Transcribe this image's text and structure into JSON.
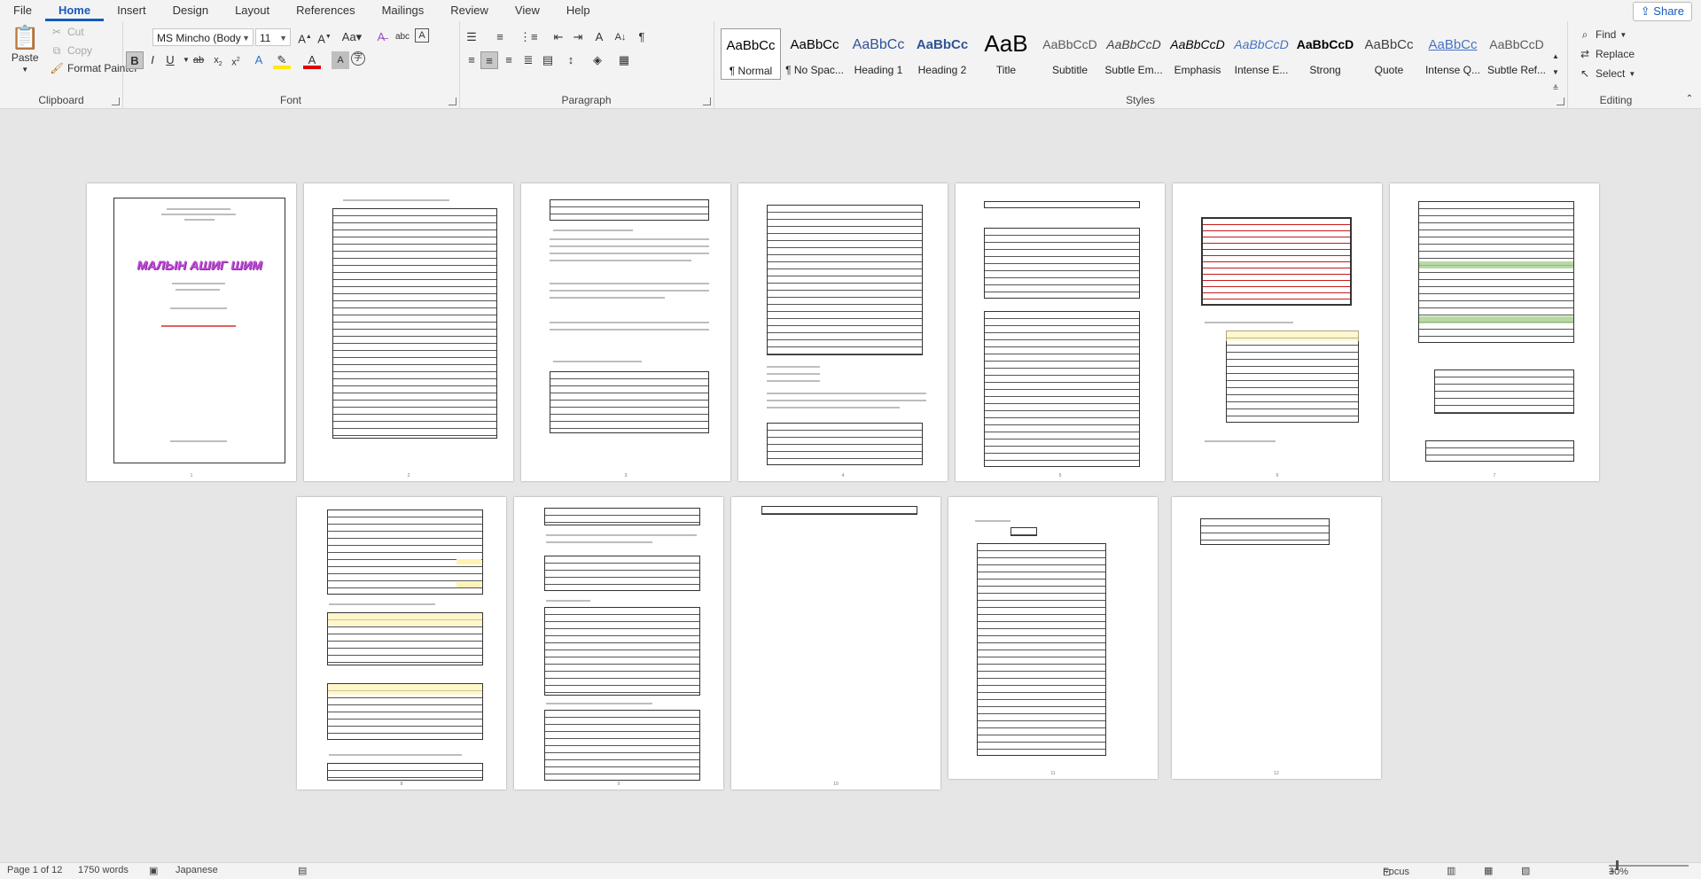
{
  "menu": {
    "tabs": [
      "File",
      "Home",
      "Insert",
      "Design",
      "Layout",
      "References",
      "Mailings",
      "Review",
      "View",
      "Help"
    ],
    "active": "Home",
    "share": "Share"
  },
  "clipboard": {
    "label": "Clipboard",
    "paste": "Paste",
    "cut": "Cut",
    "copy": "Copy",
    "format_painter": "Format Painter"
  },
  "font": {
    "label": "Font",
    "name": "MS Mincho (Body",
    "size": "11"
  },
  "paragraph": {
    "label": "Paragraph"
  },
  "styles": {
    "label": "Styles",
    "items": [
      {
        "preview": "AaBbCc",
        "name": "¶ Normal"
      },
      {
        "preview": "AaBbCc",
        "name": "¶ No Spac..."
      },
      {
        "preview": "AaBbCc",
        "name": "Heading 1"
      },
      {
        "preview": "AaBbCc",
        "name": "Heading 2"
      },
      {
        "preview": "AaB",
        "name": "Title"
      },
      {
        "preview": "AaBbCcD",
        "name": "Subtitle"
      },
      {
        "preview": "AaBbCcD",
        "name": "Subtle Em..."
      },
      {
        "preview": "AaBbCcD",
        "name": "Emphasis"
      },
      {
        "preview": "AaBbCcD",
        "name": "Intense E..."
      },
      {
        "preview": "AaBbCcD",
        "name": "Strong"
      },
      {
        "preview": "AaBbCc",
        "name": "Quote"
      },
      {
        "preview": "AaBbCc",
        "name": "Intense Q..."
      },
      {
        "preview": "AaBbCcD",
        "name": "Subtle Ref..."
      }
    ],
    "colors": [
      "#000000",
      "#000000",
      "#2f5496",
      "#2f5496",
      "#000000",
      "#595959",
      "#404040",
      "#000000",
      "#4472c4",
      "#000000",
      "#404040",
      "#4472c4",
      "#595959"
    ]
  },
  "editing": {
    "label": "Editing",
    "find": "Find",
    "replace": "Replace",
    "select": "Select"
  },
  "document": {
    "title_art": "МАЛЫН АШИГ ШИМ",
    "page_numbers": [
      "1",
      "2",
      "3",
      "4",
      "5",
      "6",
      "7",
      "8",
      "9",
      "10",
      "11",
      "12"
    ]
  },
  "status": {
    "page": "Page 1 of 12",
    "words": "1750 words",
    "language": "Japanese",
    "focus": "Focus",
    "zoom": "30%"
  }
}
